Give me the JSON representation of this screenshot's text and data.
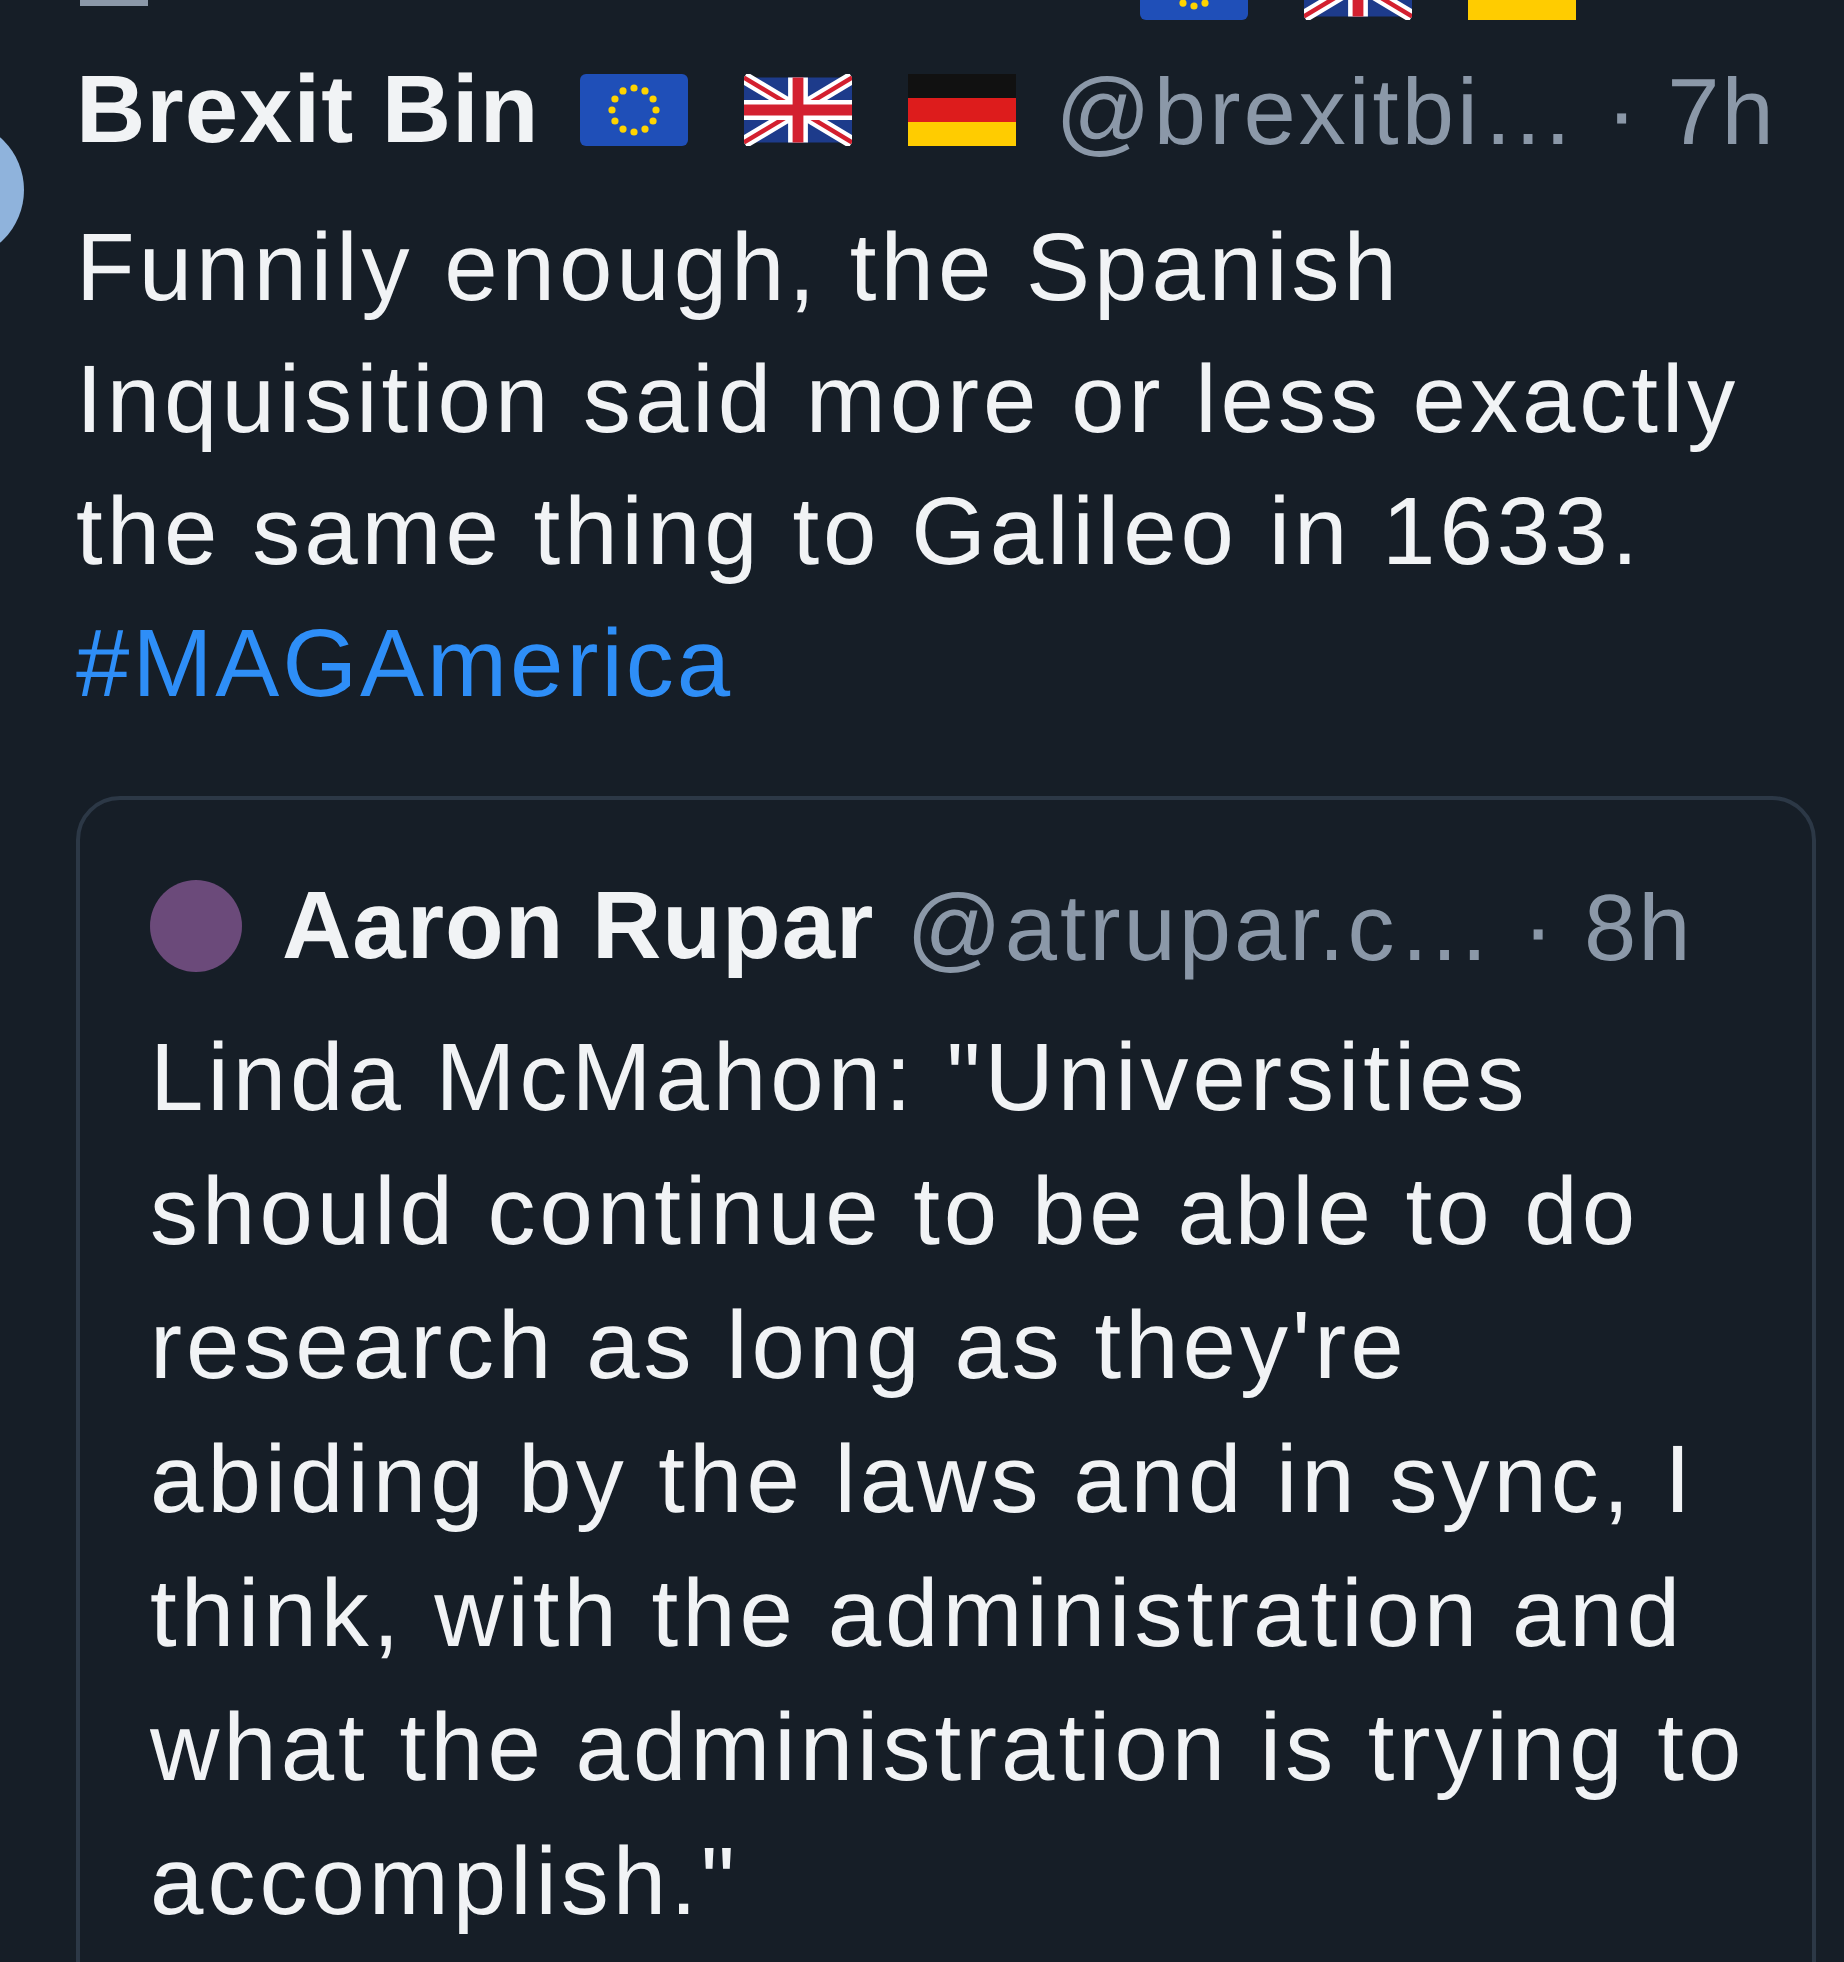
{
  "post": {
    "author": "Brexit Bin",
    "handle": "@brexitbi…",
    "time": "· 7h",
    "text": "Funnily enough, the Spanish Inquisition said more or less exactly the same thing to Galileo in 1633.",
    "hashtag": "#MAGAmerica"
  },
  "quote": {
    "author": "Aaron Rupar",
    "handle": "@atrupar.c…",
    "time": "· 8h",
    "text": "Linda McMahon: \"Universities should continue to be able to do research as long as they're abiding by the laws and in sync, I think, with the administration and what the administration is trying to accomplish.\""
  }
}
